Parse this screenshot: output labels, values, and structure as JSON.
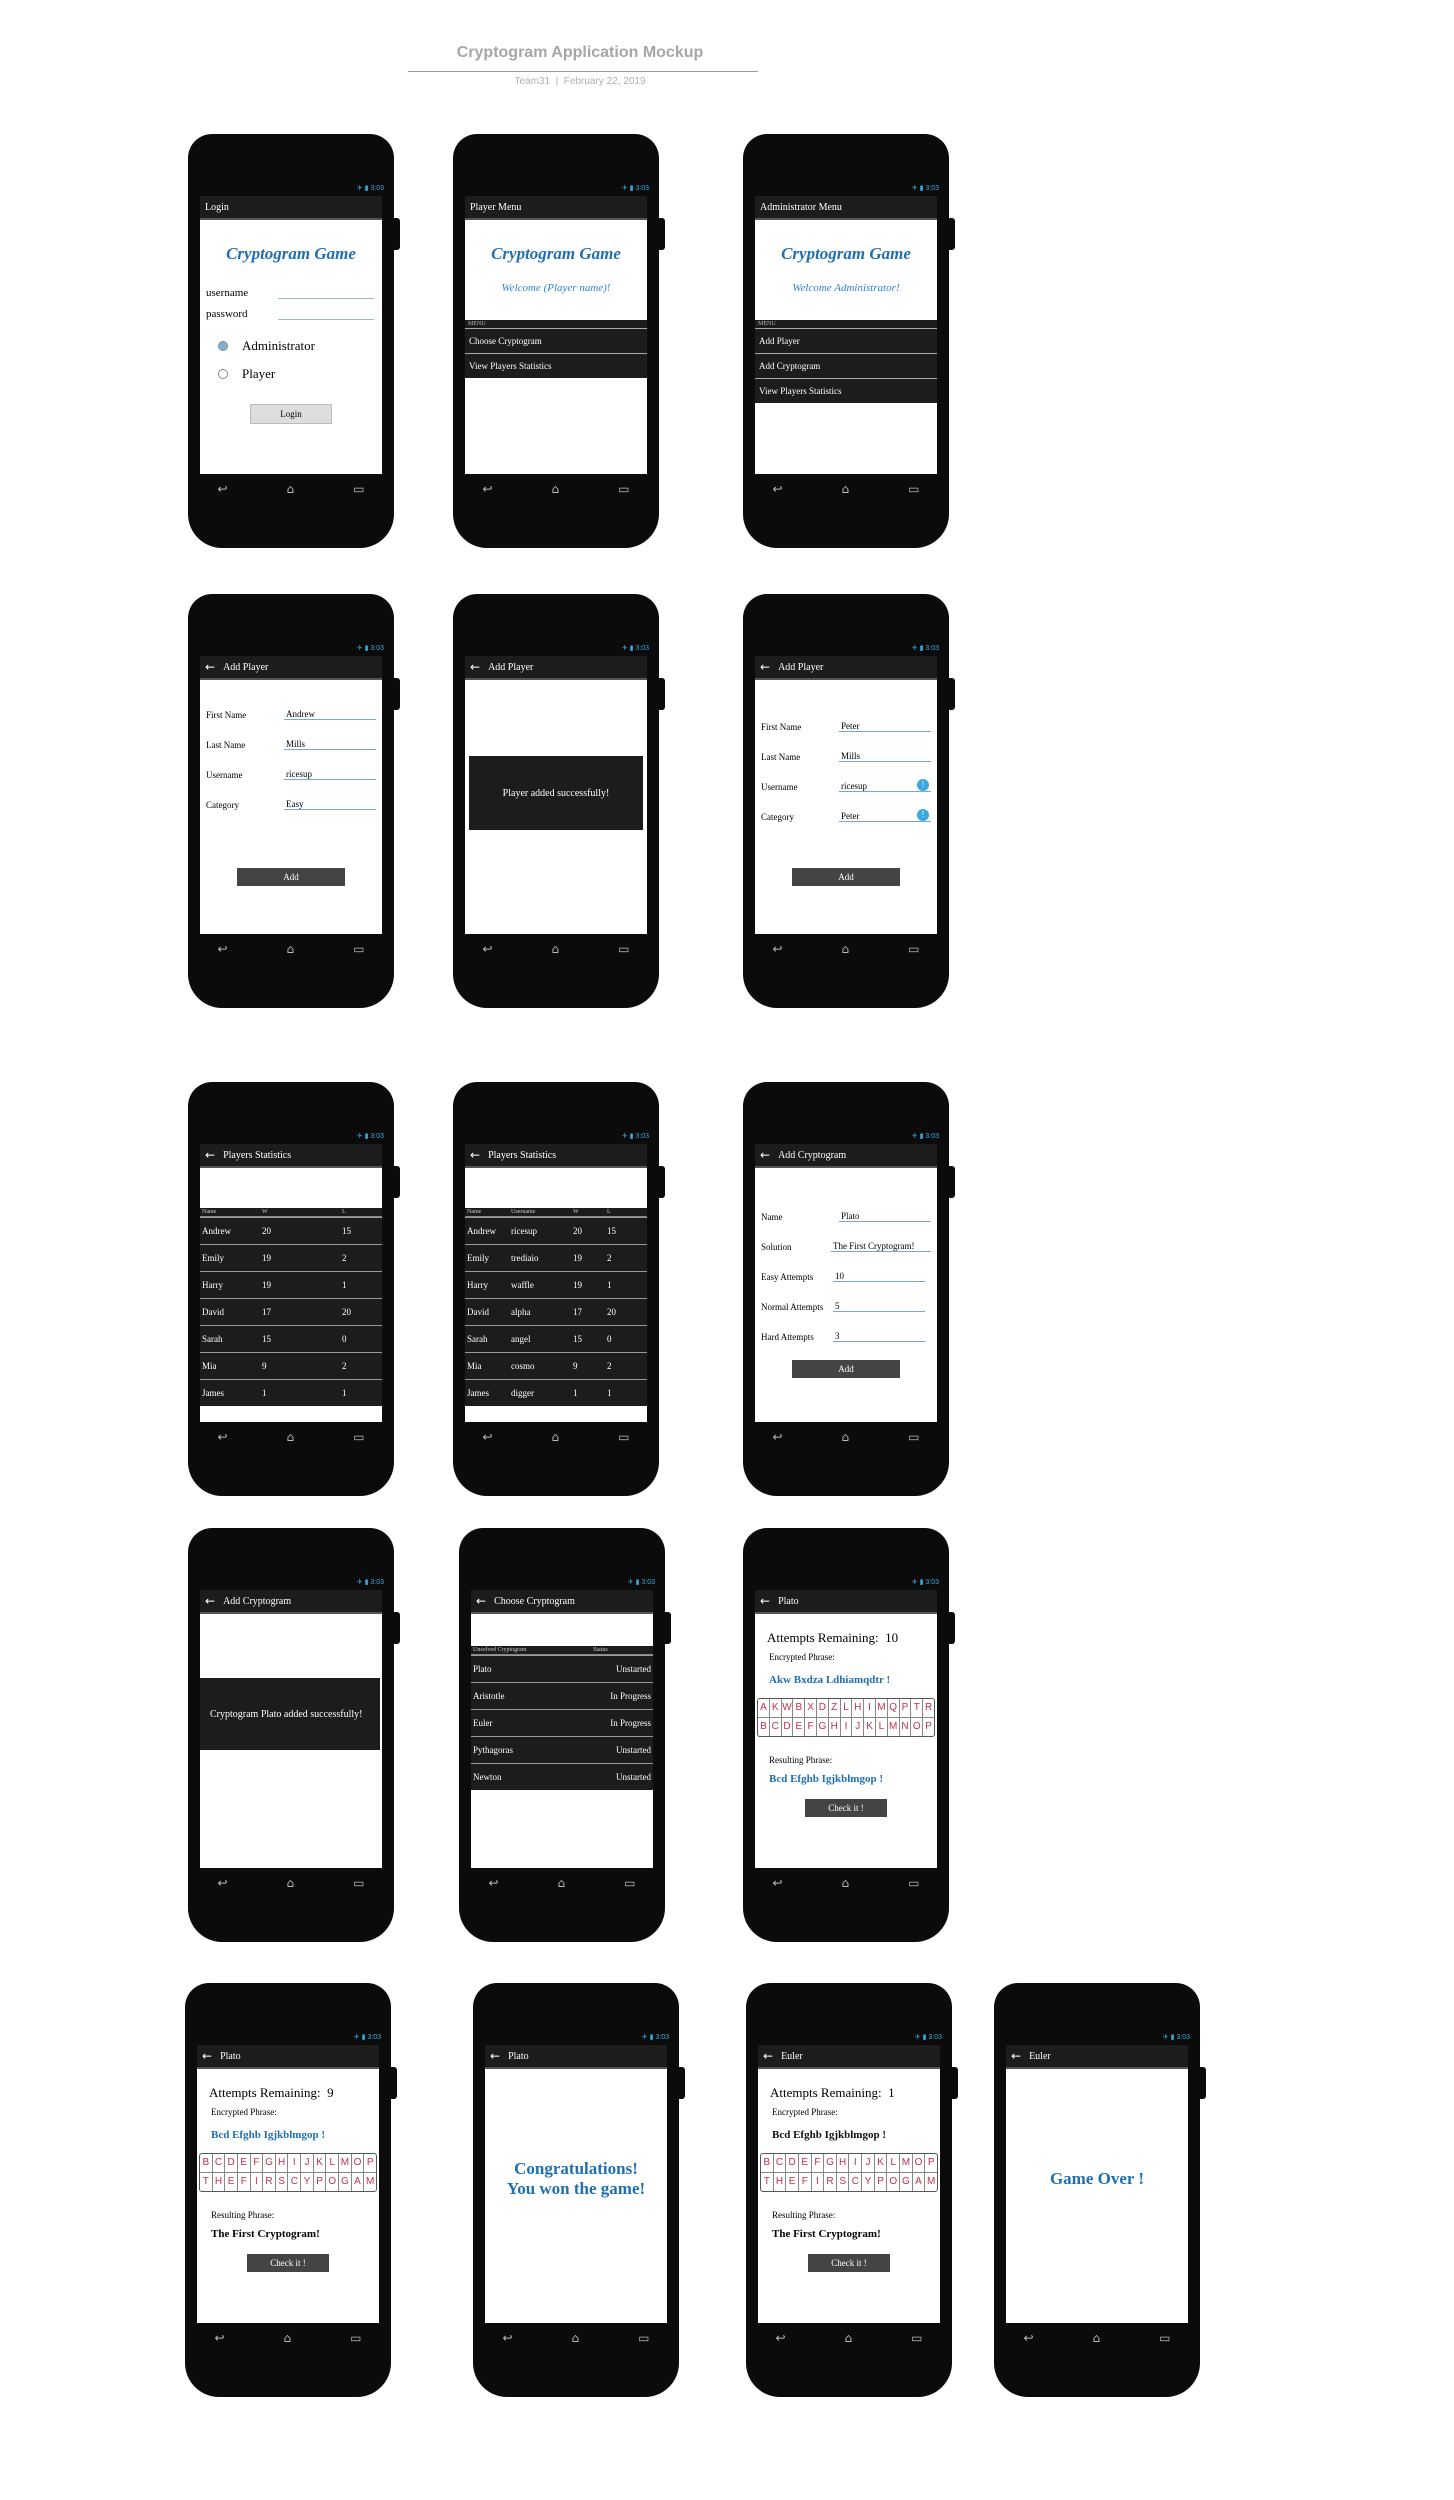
{
  "header": {
    "title": "Cryptogram Application Mockup",
    "team": "Team31",
    "date": "February 22, 2019"
  },
  "status_time": "3:03",
  "nav_icons": {
    "back": "↩",
    "home": "⌂",
    "recent": "▭"
  },
  "login": {
    "appbar": "Login",
    "title": "Cryptogram Game",
    "username_label": "username",
    "password_label": "password",
    "admin_label": "Administrator",
    "player_label": "Player",
    "button": "Login"
  },
  "player_menu": {
    "appbar": "Player Menu",
    "title": "Cryptogram Game",
    "welcome": "Welcome (Player name)!",
    "menu_caption": "MENU",
    "items": [
      "Choose Cryptogram",
      "View Players Statistics"
    ]
  },
  "admin_menu": {
    "appbar": "Administrator Menu",
    "title": "Cryptogram Game",
    "welcome": "Welcome Administrator!",
    "menu_caption": "MENU",
    "items": [
      "Add Player",
      "Add  Cryptogram",
      "View Players Statistics"
    ]
  },
  "add_player_1": {
    "appbar": "Add Player",
    "fields": [
      {
        "label": "First Name",
        "value": "Andrew"
      },
      {
        "label": "Last Name",
        "value": "Mills"
      },
      {
        "label": "Username",
        "value": "ricesup"
      },
      {
        "label": "Category",
        "value": "Easy"
      }
    ],
    "button": "Add"
  },
  "add_player_2": {
    "appbar": "Add Player",
    "toast": "Player added  successfully!"
  },
  "add_player_3": {
    "appbar": "Add Player",
    "fields": [
      {
        "label": "First Name",
        "value": "Peter"
      },
      {
        "label": "Last Name",
        "value": "Mills"
      },
      {
        "label": "Username",
        "value": "ricesup"
      },
      {
        "label": "Category",
        "value": "Peter"
      }
    ],
    "info_icon": "!",
    "button": "Add"
  },
  "stats_1": {
    "appbar": "Players Statistics",
    "headers": [
      "Name",
      "W",
      "L"
    ],
    "rows": [
      [
        "Andrew",
        "20",
        "15"
      ],
      [
        "Emily",
        "19",
        "2"
      ],
      [
        "Harry",
        "19",
        "1"
      ],
      [
        "David",
        "17",
        "20"
      ],
      [
        "Sarah",
        "15",
        "0"
      ],
      [
        "Mia",
        "9",
        "2"
      ],
      [
        "James",
        "1",
        "1"
      ]
    ]
  },
  "stats_2": {
    "appbar": "Players Statistics",
    "headers": [
      "Name",
      "Username",
      "W",
      "L"
    ],
    "rows": [
      [
        "Andrew",
        "ricesup",
        "20",
        "15"
      ],
      [
        "Emily",
        "trediaio",
        "19",
        "2"
      ],
      [
        "Harry",
        "waffle",
        "19",
        "1"
      ],
      [
        "David",
        "alpha",
        "17",
        "20"
      ],
      [
        "Sarah",
        "angel",
        "15",
        "0"
      ],
      [
        "Mia",
        "cosmo",
        "9",
        "2"
      ],
      [
        "James",
        "digger",
        "1",
        "1"
      ]
    ]
  },
  "add_cryptogram": {
    "appbar": "Add Cryptogram",
    "fields": [
      {
        "label": "Name",
        "value": "Plato"
      },
      {
        "label": "Solution",
        "value": "The First Cryptogram!"
      },
      {
        "label": "Easy Attempts",
        "value": "10"
      },
      {
        "label": "Normal Attempts",
        "value": "5"
      },
      {
        "label": "Hard Attempts",
        "value": "3"
      }
    ],
    "button": "Add"
  },
  "add_cryptogram_done": {
    "appbar": "Add Cryptogram",
    "toast": "Cryptogram Plato added successfully!"
  },
  "choose_cryptogram": {
    "appbar": "Choose Cryptogram",
    "headers": [
      "Unsolved Cryptogram",
      "Status"
    ],
    "rows": [
      [
        "Plato",
        "Unstarted"
      ],
      [
        "Aristotle",
        "In Progress"
      ],
      [
        "Euler",
        "In Progress"
      ],
      [
        "Pythagoras",
        "Unstarted"
      ],
      [
        "Newton",
        "Unstarted"
      ]
    ]
  },
  "game_1": {
    "appbar": "Plato",
    "attempts_label": "Attempts Remaining:",
    "attempts": "10",
    "encrypted_label": "Encrypted Phrase:",
    "encrypted": "Akw Bxdza Ldhiamqdtr !",
    "kb_top": [
      "A",
      "K",
      "W",
      "B",
      "X",
      "D",
      "Z",
      "L",
      "H",
      "I",
      "M",
      "Q",
      "P",
      "T",
      "R"
    ],
    "kb_bottom": [
      "B",
      "C",
      "D",
      "E",
      "F",
      "G",
      "H",
      "I",
      "J",
      "K",
      "L",
      "M",
      "N",
      "O",
      "P"
    ],
    "result_label": "Resulting Phrase:",
    "result": "Bcd Efghb Igjkblmgop !",
    "button": "Check it !"
  },
  "game_2": {
    "appbar": "Plato",
    "attempts_label": "Attempts Remaining:",
    "attempts": "9",
    "encrypted_label": "Encrypted Phrase:",
    "encrypted": "Bcd Efghb Igjkblmgop !",
    "kb_top": [
      "B",
      "C",
      "D",
      "E",
      "F",
      "G",
      "H",
      "I",
      "J",
      "K",
      "L",
      "M",
      "O",
      "P"
    ],
    "kb_bottom": [
      "T",
      "H",
      "E",
      "F",
      "I",
      "R",
      "S",
      "C",
      "Y",
      "P",
      "O",
      "G",
      "A",
      "M"
    ],
    "result_label": "Resulting Phrase:",
    "result": "The First Cryptogram!",
    "button": "Check it !"
  },
  "game_won": {
    "appbar": "Plato",
    "line1": "Congratulations!",
    "line2": "You won the game!"
  },
  "game_3": {
    "appbar": "Euler",
    "attempts_label": "Attempts Remaining:",
    "attempts": "1",
    "encrypted_label": "Encrypted Phrase:",
    "encrypted": "Bcd Efghb Igjkblmgop !",
    "kb_top": [
      "B",
      "C",
      "D",
      "E",
      "F",
      "G",
      "H",
      "I",
      "J",
      "K",
      "L",
      "M",
      "O",
      "P"
    ],
    "kb_bottom": [
      "T",
      "H",
      "E",
      "F",
      "I",
      "R",
      "S",
      "C",
      "Y",
      "P",
      "O",
      "G",
      "A",
      "M"
    ],
    "result_label": "Resulting Phrase:",
    "result": "The First Cryptogram!",
    "button": "Check it !"
  },
  "game_over": {
    "appbar": "Euler",
    "message": "Game Over !"
  }
}
